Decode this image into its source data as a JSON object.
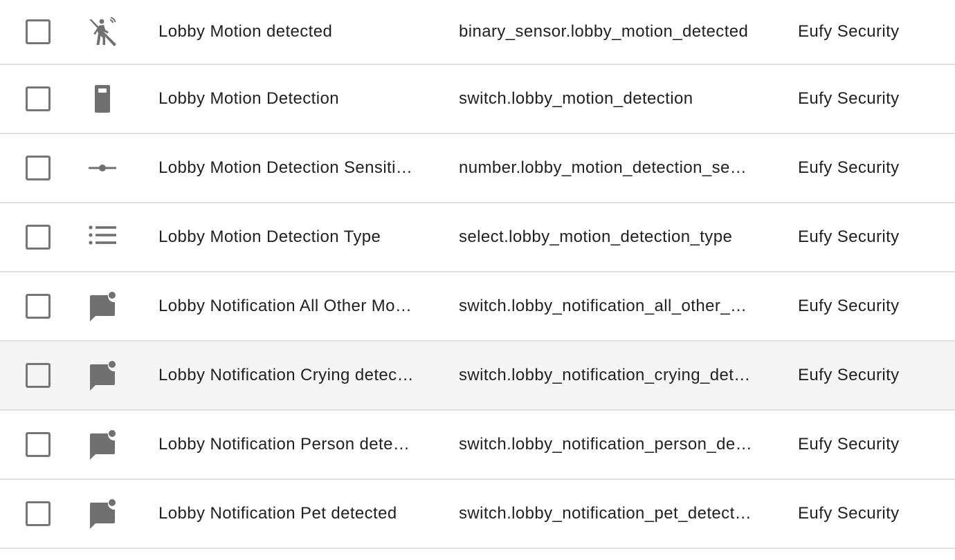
{
  "rows": [
    {
      "icon": "motion-sensor-icon",
      "name": "Lobby Motion detected",
      "entity_id": "binary_sensor.lobby_motion_detected",
      "integration": "Eufy Security"
    },
    {
      "icon": "remote-switch-icon",
      "name": "Lobby Motion Detection",
      "entity_id": "switch.lobby_motion_detection",
      "integration": "Eufy Security"
    },
    {
      "icon": "slider-number-icon",
      "name": "Lobby Motion Detection Sensitivity",
      "entity_id": "number.lobby_motion_detection_sensitivity",
      "integration": "Eufy Security"
    },
    {
      "icon": "format-list-icon",
      "name": "Lobby Motion Detection Type",
      "entity_id": "select.lobby_motion_detection_type",
      "integration": "Eufy Security"
    },
    {
      "icon": "message-badge-icon",
      "name": "Lobby Notification All Other Motion",
      "entity_id": "switch.lobby_notification_all_other_motion",
      "integration": "Eufy Security"
    },
    {
      "icon": "message-badge-icon",
      "name": "Lobby Notification Crying detected",
      "entity_id": "switch.lobby_notification_crying_detected",
      "integration": "Eufy Security"
    },
    {
      "icon": "message-badge-icon",
      "name": "Lobby Notification Person detected",
      "entity_id": "switch.lobby_notification_person_detected",
      "integration": "Eufy Security"
    },
    {
      "icon": "message-badge-icon",
      "name": "Lobby Notification Pet detected",
      "entity_id": "switch.lobby_notification_pet_detected",
      "integration": "Eufy Security"
    }
  ],
  "colors": {
    "icon": "#707070",
    "checkbox_border": "#757575",
    "divider": "#e0e0e0",
    "hover_row": "#f5f5f5",
    "text": "#212121"
  }
}
